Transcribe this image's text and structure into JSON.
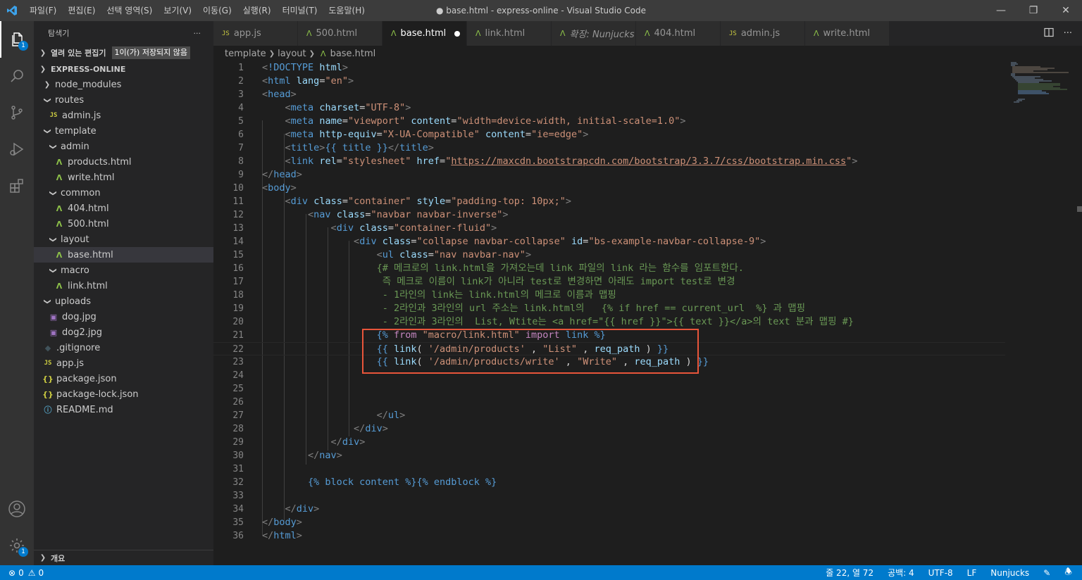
{
  "app": {
    "window_title": "● base.html - express-online - Visual Studio Code",
    "menu": [
      "파일(F)",
      "편집(E)",
      "선택 영역(S)",
      "보기(V)",
      "이동(G)",
      "실행(R)",
      "터미널(T)",
      "도움말(H)"
    ]
  },
  "activity": {
    "explorer_badge": "1",
    "settings_badge": "1"
  },
  "sidebar": {
    "title": "탐색기",
    "more": "···",
    "open_editors": "열려 있는 편집기",
    "unsaved_badge": "1이(가) 저장되지 않음",
    "project": "EXPRESS-ONLINE",
    "outline": "개요",
    "tree": [
      {
        "label": "node_modules",
        "type": "folder-closed"
      },
      {
        "label": "routes",
        "type": "folder-open"
      },
      {
        "label": "admin.js",
        "type": "js"
      },
      {
        "label": "template",
        "type": "folder-open"
      },
      {
        "label": "admin",
        "type": "folder-open"
      },
      {
        "label": "products.html",
        "type": "html"
      },
      {
        "label": "write.html",
        "type": "html"
      },
      {
        "label": "common",
        "type": "folder-open"
      },
      {
        "label": "404.html",
        "type": "html"
      },
      {
        "label": "500.html",
        "type": "html"
      },
      {
        "label": "layout",
        "type": "folder-open"
      },
      {
        "label": "base.html",
        "type": "html"
      },
      {
        "label": "macro",
        "type": "folder-open"
      },
      {
        "label": "link.html",
        "type": "html"
      },
      {
        "label": "uploads",
        "type": "folder-open"
      },
      {
        "label": "dog.jpg",
        "type": "img"
      },
      {
        "label": "dog2.jpg",
        "type": "img"
      },
      {
        "label": ".gitignore",
        "type": "git"
      },
      {
        "label": "app.js",
        "type": "js"
      },
      {
        "label": "package.json",
        "type": "json"
      },
      {
        "label": "package-lock.json",
        "type": "json"
      },
      {
        "label": "README.md",
        "type": "md"
      }
    ]
  },
  "tabs": [
    {
      "label": "app.js",
      "icon": "JS"
    },
    {
      "label": "500.html",
      "icon": "html"
    },
    {
      "label": "base.html",
      "icon": "html"
    },
    {
      "label": "link.html",
      "icon": "html"
    },
    {
      "label": "확장: Nunjucks",
      "icon": "html"
    },
    {
      "label": "404.html",
      "icon": "html"
    },
    {
      "label": "admin.js",
      "icon": "JS"
    },
    {
      "label": "write.html",
      "icon": "html"
    }
  ],
  "breadcrumb": [
    "template",
    "layout",
    "base.html"
  ],
  "editor": {
    "line_numbers": [
      "1",
      "2",
      "3",
      "4",
      "5",
      "6",
      "7",
      "8",
      "9",
      "10",
      "11",
      "12",
      "13",
      "14",
      "15",
      "16",
      "17",
      "18",
      "19",
      "20",
      "21",
      "22",
      "23",
      "24",
      "25",
      "26",
      "27",
      "28",
      "29",
      "30",
      "31",
      "32",
      "33",
      "34",
      "35",
      "36"
    ],
    "lines": [
      [
        [
          "p",
          "<"
        ],
        [
          "t",
          "!DOCTYPE"
        ],
        [
          "w",
          " "
        ],
        [
          "a",
          "html"
        ],
        [
          "p",
          ">"
        ]
      ],
      [
        [
          "p",
          "<"
        ],
        [
          "t",
          "html"
        ],
        [
          "w",
          " "
        ],
        [
          "a",
          "lang"
        ],
        [
          "w",
          "="
        ],
        [
          "s",
          "\"en\""
        ],
        [
          "p",
          ">"
        ]
      ],
      [
        [
          "p",
          "<"
        ],
        [
          "t",
          "head"
        ],
        [
          "p",
          ">"
        ]
      ],
      [
        [
          "w",
          "    "
        ],
        [
          "p",
          "<"
        ],
        [
          "t",
          "meta"
        ],
        [
          "w",
          " "
        ],
        [
          "a",
          "charset"
        ],
        [
          "w",
          "="
        ],
        [
          "s",
          "\"UTF-8\""
        ],
        [
          "p",
          ">"
        ]
      ],
      [
        [
          "w",
          "    "
        ],
        [
          "p",
          "<"
        ],
        [
          "t",
          "meta"
        ],
        [
          "w",
          " "
        ],
        [
          "a",
          "name"
        ],
        [
          "w",
          "="
        ],
        [
          "s",
          "\"viewport\""
        ],
        [
          "w",
          " "
        ],
        [
          "a",
          "content"
        ],
        [
          "w",
          "="
        ],
        [
          "s",
          "\"width=device-width, initial-scale=1.0\""
        ],
        [
          "p",
          ">"
        ]
      ],
      [
        [
          "w",
          "    "
        ],
        [
          "p",
          "<"
        ],
        [
          "t",
          "meta"
        ],
        [
          "w",
          " "
        ],
        [
          "a",
          "http-equiv"
        ],
        [
          "w",
          "="
        ],
        [
          "s",
          "\"X-UA-Compatible\""
        ],
        [
          "w",
          " "
        ],
        [
          "a",
          "content"
        ],
        [
          "w",
          "="
        ],
        [
          "s",
          "\"ie=edge\""
        ],
        [
          "p",
          ">"
        ]
      ],
      [
        [
          "w",
          "    "
        ],
        [
          "p",
          "<"
        ],
        [
          "t",
          "title"
        ],
        [
          "p",
          ">"
        ],
        [
          "n",
          "{{ title }}"
        ],
        [
          "p",
          "</"
        ],
        [
          "t",
          "title"
        ],
        [
          "p",
          ">"
        ]
      ],
      [
        [
          "w",
          "    "
        ],
        [
          "p",
          "<"
        ],
        [
          "t",
          "link"
        ],
        [
          "w",
          " "
        ],
        [
          "a",
          "rel"
        ],
        [
          "w",
          "="
        ],
        [
          "s",
          "\"stylesheet\""
        ],
        [
          "w",
          " "
        ],
        [
          "a",
          "href"
        ],
        [
          "w",
          "="
        ],
        [
          "s",
          "\""
        ],
        [
          "u",
          "https://maxcdn.bootstrapcdn.com/bootstrap/3.3.7/css/bootstrap.min.css"
        ],
        [
          "s",
          "\""
        ],
        [
          "p",
          ">"
        ]
      ],
      [
        [
          "p",
          "</"
        ],
        [
          "t",
          "head"
        ],
        [
          "p",
          ">"
        ]
      ],
      [
        [
          "p",
          "<"
        ],
        [
          "t",
          "body"
        ],
        [
          "p",
          ">"
        ]
      ],
      [
        [
          "w",
          "    "
        ],
        [
          "p",
          "<"
        ],
        [
          "t",
          "div"
        ],
        [
          "w",
          " "
        ],
        [
          "a",
          "class"
        ],
        [
          "w",
          "="
        ],
        [
          "s",
          "\"container\""
        ],
        [
          "w",
          " "
        ],
        [
          "a",
          "style"
        ],
        [
          "w",
          "="
        ],
        [
          "s",
          "\"padding-top: 10px;\""
        ],
        [
          "p",
          ">"
        ]
      ],
      [
        [
          "w",
          "        "
        ],
        [
          "p",
          "<"
        ],
        [
          "t",
          "nav"
        ],
        [
          "w",
          " "
        ],
        [
          "a",
          "class"
        ],
        [
          "w",
          "="
        ],
        [
          "s",
          "\"navbar navbar-inverse\""
        ],
        [
          "p",
          ">"
        ]
      ],
      [
        [
          "w",
          "            "
        ],
        [
          "p",
          "<"
        ],
        [
          "t",
          "div"
        ],
        [
          "w",
          " "
        ],
        [
          "a",
          "class"
        ],
        [
          "w",
          "="
        ],
        [
          "s",
          "\"container-fluid\""
        ],
        [
          "p",
          ">"
        ]
      ],
      [
        [
          "w",
          "                "
        ],
        [
          "p",
          "<"
        ],
        [
          "t",
          "div"
        ],
        [
          "w",
          " "
        ],
        [
          "a",
          "class"
        ],
        [
          "w",
          "="
        ],
        [
          "s",
          "\"collapse navbar-collapse\""
        ],
        [
          "w",
          " "
        ],
        [
          "a",
          "id"
        ],
        [
          "w",
          "="
        ],
        [
          "s",
          "\"bs-example-navbar-collapse-9\""
        ],
        [
          "p",
          ">"
        ]
      ],
      [
        [
          "w",
          "                    "
        ],
        [
          "p",
          "<"
        ],
        [
          "t",
          "ul"
        ],
        [
          "w",
          " "
        ],
        [
          "a",
          "class"
        ],
        [
          "w",
          "="
        ],
        [
          "s",
          "\"nav navbar-nav\""
        ],
        [
          "p",
          ">"
        ]
      ],
      [
        [
          "w",
          "                    "
        ],
        [
          "c",
          "{# 메크로의 link.html을 가져오는데 link 파일의 link 라는 함수를 임포트한다."
        ]
      ],
      [
        [
          "w",
          "                     "
        ],
        [
          "c",
          "즉 메크로 이름이 link가 아니라 test로 변경하면 아래도 import test로 변경"
        ]
      ],
      [
        [
          "w",
          "                     "
        ],
        [
          "c",
          "- 1라인의 link는 link.html의 메크로 이름과 맵핑"
        ]
      ],
      [
        [
          "w",
          "                     "
        ],
        [
          "c",
          "- 2라인과 3라인의 url 주소는 link.html의   {% if href == current_url  %} 과 맵핑"
        ]
      ],
      [
        [
          "w",
          "                     "
        ],
        [
          "c",
          "- 2라인과 3라인의  List, Wtite는 <a href=\"{{ href }}\">{{ text }}</a>의 text 분과 맵핑 #}"
        ]
      ],
      [
        [
          "w",
          "                    "
        ],
        [
          "n",
          "{% "
        ],
        [
          "k",
          "from"
        ],
        [
          "w",
          " "
        ],
        [
          "s",
          "\"macro/link.html\""
        ],
        [
          "w",
          " "
        ],
        [
          "k",
          "import"
        ],
        [
          "w",
          " "
        ],
        [
          "n",
          "link %}"
        ]
      ],
      [
        [
          "w",
          "                    "
        ],
        [
          "n",
          "{{ "
        ],
        [
          "a",
          "link"
        ],
        [
          "w",
          "( "
        ],
        [
          "s",
          "'/admin/products'"
        ],
        [
          "w",
          " , "
        ],
        [
          "s",
          "\"List\""
        ],
        [
          "w",
          " , "
        ],
        [
          "a",
          "req_path"
        ],
        [
          "w",
          " ) "
        ],
        [
          "n",
          "}}"
        ]
      ],
      [
        [
          "w",
          "                    "
        ],
        [
          "n",
          "{{ "
        ],
        [
          "a",
          "link"
        ],
        [
          "w",
          "( "
        ],
        [
          "s",
          "'/admin/products/write'"
        ],
        [
          "w",
          " , "
        ],
        [
          "s",
          "\"Write\""
        ],
        [
          "w",
          " , "
        ],
        [
          "a",
          "req_path"
        ],
        [
          "w",
          " ) "
        ],
        [
          "n",
          "}}"
        ]
      ],
      [],
      [],
      [],
      [
        [
          "w",
          "                    "
        ],
        [
          "p",
          "</"
        ],
        [
          "t",
          "ul"
        ],
        [
          "p",
          ">"
        ]
      ],
      [
        [
          "w",
          "                "
        ],
        [
          "p",
          "</"
        ],
        [
          "t",
          "div"
        ],
        [
          "p",
          ">"
        ]
      ],
      [
        [
          "w",
          "            "
        ],
        [
          "p",
          "</"
        ],
        [
          "t",
          "div"
        ],
        [
          "p",
          ">"
        ]
      ],
      [
        [
          "w",
          "        "
        ],
        [
          "p",
          "</"
        ],
        [
          "t",
          "nav"
        ],
        [
          "p",
          ">"
        ]
      ],
      [],
      [
        [
          "w",
          "        "
        ],
        [
          "n",
          "{% block content %}{% endblock %}"
        ]
      ],
      [],
      [
        [
          "w",
          "    "
        ],
        [
          "p",
          "</"
        ],
        [
          "t",
          "div"
        ],
        [
          "p",
          ">"
        ]
      ],
      [
        [
          "p",
          "</"
        ],
        [
          "t",
          "body"
        ],
        [
          "p",
          ">"
        ]
      ],
      [
        [
          "p",
          "</"
        ],
        [
          "t",
          "html"
        ],
        [
          "p",
          ">"
        ]
      ]
    ]
  },
  "status": {
    "errors": "0",
    "warnings": "0",
    "position": "줄 22, 열 72",
    "spaces": "공백: 4",
    "encoding": "UTF-8",
    "eol": "LF",
    "language": "Nunjucks"
  }
}
